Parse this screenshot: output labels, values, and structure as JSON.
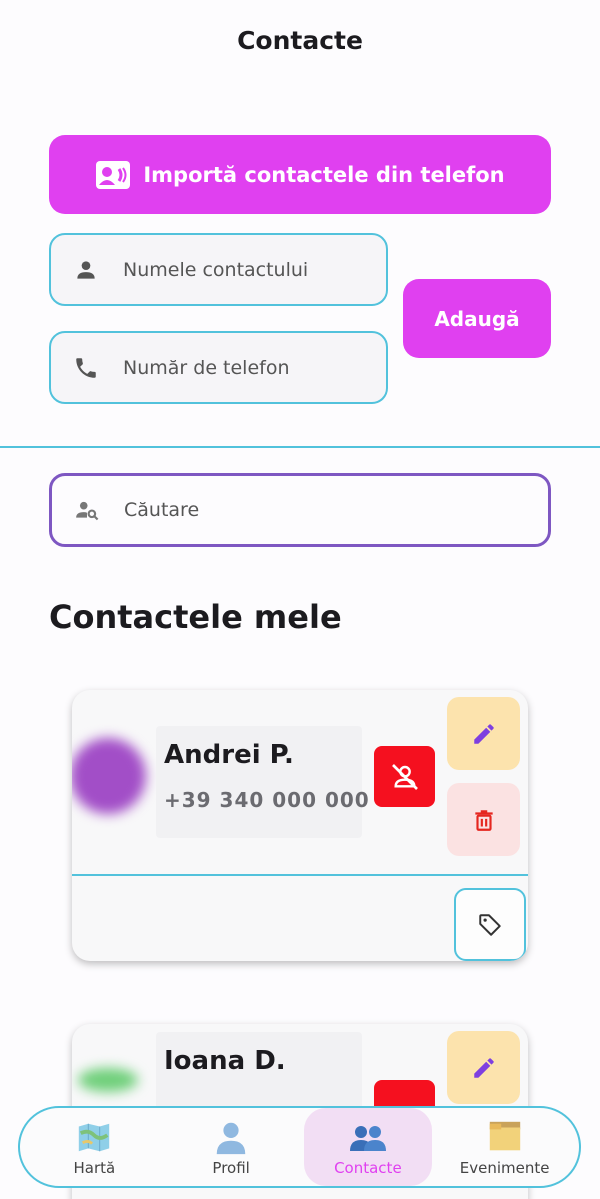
{
  "header": {
    "title": "Contacte"
  },
  "form": {
    "import_label": "Importă contactele din telefon",
    "name_placeholder": "Numele contactului",
    "phone_placeholder": "Număr de telefon",
    "add_label": "Adaugă"
  },
  "search": {
    "placeholder": "Căutare"
  },
  "section": {
    "title": "Contactele mele"
  },
  "contacts": [
    {
      "name": "Andrei P.",
      "phone": "+39 340 000 000"
    },
    {
      "name": "Ioana D.",
      "phone": ""
    }
  ],
  "nav": {
    "items": [
      {
        "label": "Hartă",
        "icon": "map-icon"
      },
      {
        "label": "Profil",
        "icon": "person-icon"
      },
      {
        "label": "Contacte",
        "icon": "people-icon"
      },
      {
        "label": "Evenimente",
        "icon": "folder-icon"
      }
    ],
    "active": "Contacte"
  },
  "colors": {
    "accent": "#e040f0",
    "border_cyan": "#52c2dc",
    "search_border": "#7e57c2",
    "block_red": "#f5101f",
    "edit_bg": "#fce3ad",
    "delete_bg": "#fbe2e2"
  }
}
